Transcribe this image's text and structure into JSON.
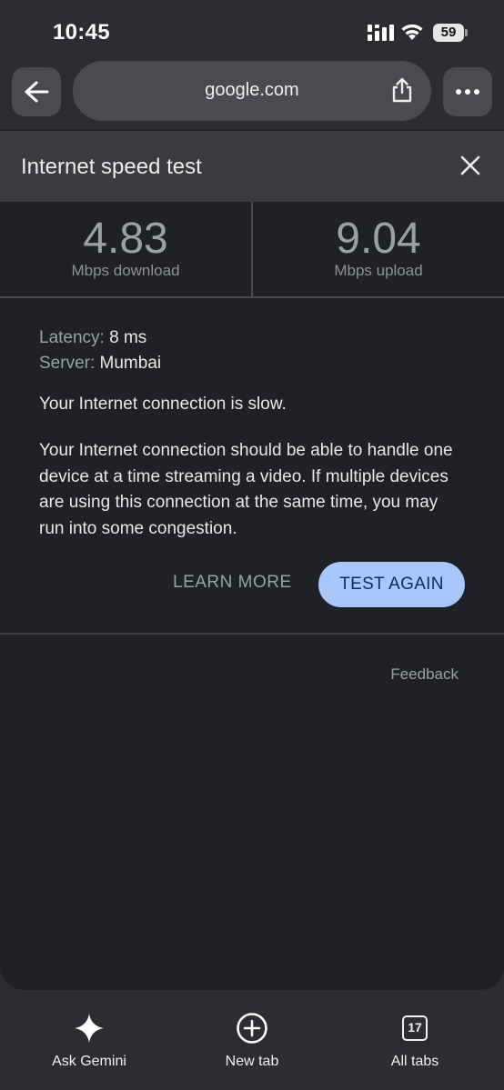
{
  "status_bar": {
    "time": "10:45",
    "battery": "59",
    "icons": [
      "signal-icon",
      "wifi-icon",
      "battery-icon"
    ]
  },
  "toolbar": {
    "url": "google.com",
    "icons": [
      "back-arrow-icon",
      "share-icon",
      "more-dots-icon"
    ]
  },
  "sheet": {
    "title": "Internet speed test",
    "close_icon": "close-icon"
  },
  "results": {
    "download": {
      "value": "4.83",
      "label": "Mbps download"
    },
    "upload": {
      "value": "9.04",
      "label": "Mbps upload"
    },
    "latency_label": "Latency:",
    "latency_value": "8 ms",
    "server_label": "Server:",
    "server_value": "Mumbai",
    "status": "Your Internet connection is slow.",
    "description": "Your Internet connection should be able to handle one device at a time streaming a video. If multiple devices are using this connection at the same time, you may run into some congestion."
  },
  "actions": {
    "learn_more": "LEARN MORE",
    "test_again": "TEST AGAIN",
    "feedback": "Feedback"
  },
  "bottom_bar": {
    "ask_gemini": "Ask Gemini",
    "new_tab": "New tab",
    "all_tabs": "All tabs",
    "tab_count": "17"
  },
  "colors": {
    "background": "#202124",
    "header": "#3a3b3f",
    "accent_button": "#a8c7fa",
    "accent_text": "#062e6f",
    "muted_text": "#9aa0a6"
  }
}
